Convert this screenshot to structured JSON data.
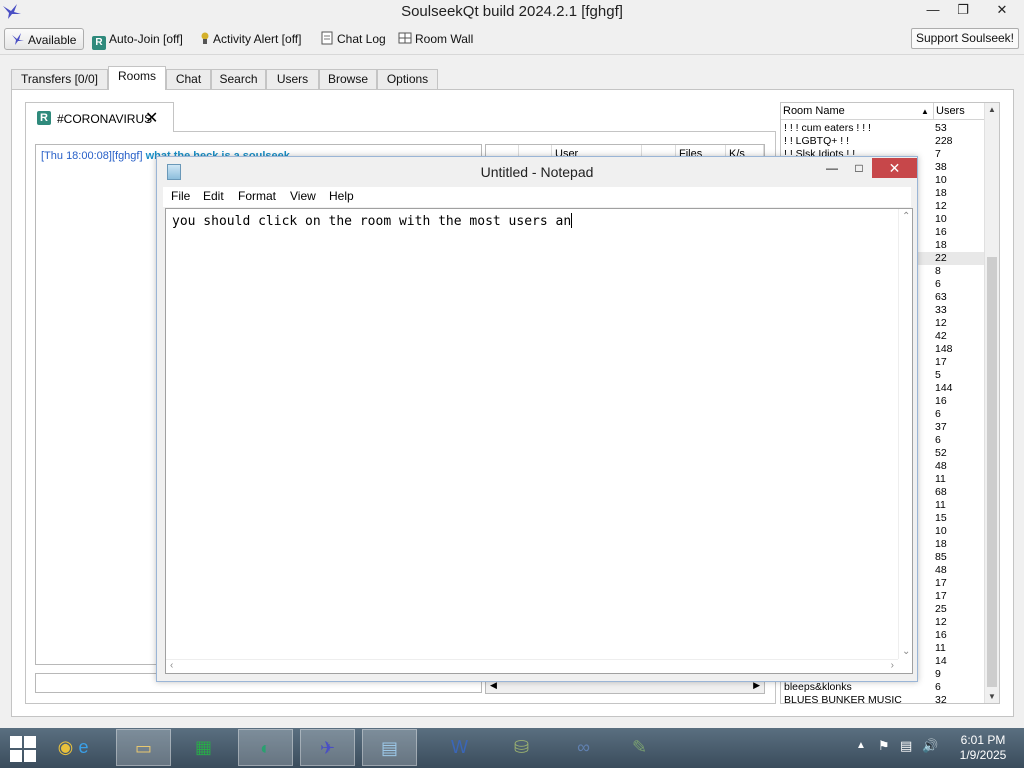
{
  "window": {
    "title": "SoulseekQt build 2024.2.1 [fghgf]",
    "minimize_icon": "minimize-icon",
    "restore_icon": "restore-icon",
    "close_icon": "close-icon"
  },
  "toolbar": {
    "available_label": "Available",
    "autojoin_label": "Auto-Join [off]",
    "activity_label": "Activity Alert [off]",
    "chatlog_label": "Chat Log",
    "roomwall_label": "Room Wall",
    "support_label": "Support Soulseek!"
  },
  "tabs": [
    "Transfers [0/0]",
    "Rooms",
    "Chat",
    "Search",
    "Users",
    "Browse",
    "Options"
  ],
  "room": {
    "tab_icon_letter": "R",
    "name": "#CORONAVIRUS",
    "close_glyph": "✕",
    "chat": {
      "timestamp": "[Thu 18:00:08]",
      "user": "[fghgf]",
      "message": "what the heck is a soulseek"
    },
    "userlist_headers": [
      "User",
      "Files",
      "K/s"
    ]
  },
  "room_list": {
    "header_name": "Room Name",
    "header_users": "Users",
    "rows": [
      {
        "name": "! ! ! cum eaters ! ! !",
        "users": "53"
      },
      {
        "name": "! ! LGBTQ+ ! !",
        "users": "228"
      },
      {
        "name": "! ! Slsk Idiots ! !",
        "users": "7"
      },
      {
        "name": "",
        "users": "38"
      },
      {
        "name": "",
        "users": "10"
      },
      {
        "name": "",
        "users": "18"
      },
      {
        "name": "",
        "users": "12"
      },
      {
        "name": "",
        "users": "10"
      },
      {
        "name": "",
        "users": "16"
      },
      {
        "name": "",
        "users": "18"
      },
      {
        "name": "",
        "users": "22"
      },
      {
        "name": "",
        "users": "8"
      },
      {
        "name": "",
        "users": "6"
      },
      {
        "name": "",
        "users": "63"
      },
      {
        "name": "",
        "users": "33"
      },
      {
        "name": "",
        "users": "12"
      },
      {
        "name": "",
        "users": "42"
      },
      {
        "name": "",
        "users": "148"
      },
      {
        "name": "",
        "users": "17"
      },
      {
        "name": "",
        "users": "5"
      },
      {
        "name": "",
        "users": "144"
      },
      {
        "name": "",
        "users": "16"
      },
      {
        "name": "",
        "users": "6"
      },
      {
        "name": "",
        "users": "37"
      },
      {
        "name": "",
        "users": "6"
      },
      {
        "name": "",
        "users": "52"
      },
      {
        "name": "",
        "users": "48"
      },
      {
        "name": "",
        "users": "11"
      },
      {
        "name": "",
        "users": "68"
      },
      {
        "name": "",
        "users": "11"
      },
      {
        "name": "",
        "users": "15"
      },
      {
        "name": "",
        "users": "10"
      },
      {
        "name": "",
        "users": "18"
      },
      {
        "name": "",
        "users": "85"
      },
      {
        "name": "",
        "users": "48"
      },
      {
        "name": "",
        "users": "17"
      },
      {
        "name": "",
        "users": "17"
      },
      {
        "name": "",
        "users": "25"
      },
      {
        "name": "",
        "users": "12"
      },
      {
        "name": "",
        "users": "16"
      },
      {
        "name": "",
        "users": "11"
      },
      {
        "name": "",
        "users": "14"
      },
      {
        "name": "",
        "users": "9"
      },
      {
        "name": "bleeps&klonks",
        "users": "6"
      },
      {
        "name": "BLUES BUNKER MUSIC",
        "users": "32"
      }
    ],
    "selected_users": "22"
  },
  "notepad": {
    "title": "Untitled - Notepad",
    "menu": [
      "File",
      "Edit",
      "Format",
      "View",
      "Help"
    ],
    "text": "you should click on the room with the most users an"
  },
  "taskbar": {
    "apps": [
      {
        "icon": "chrome-icon",
        "glyph": "◉",
        "open": false
      },
      {
        "icon": "ie-icon",
        "glyph": "e",
        "open": false
      },
      {
        "icon": "file-explorer-icon",
        "glyph": "▭",
        "open": true
      },
      {
        "icon": "store-icon",
        "glyph": "▦",
        "open": false
      },
      {
        "icon": "app-circle-icon",
        "glyph": "◐",
        "open": true
      },
      {
        "icon": "soulseek-icon",
        "glyph": "✈",
        "open": true
      },
      {
        "icon": "notepad-icon",
        "glyph": "▤",
        "open": true
      },
      {
        "icon": "word-icon",
        "glyph": "W",
        "open": false
      },
      {
        "icon": "network-app-icon",
        "glyph": "⛁",
        "open": false
      },
      {
        "icon": "link-app-icon",
        "glyph": "∞",
        "open": false
      },
      {
        "icon": "paint-icon",
        "glyph": "✎",
        "open": false
      }
    ],
    "time": "6:01 PM",
    "date": "1/9/2025"
  },
  "colors": {
    "notepad_close": "#c7474a",
    "chat_link": "#1a90c8",
    "taskbar": "#4a5d6e"
  }
}
